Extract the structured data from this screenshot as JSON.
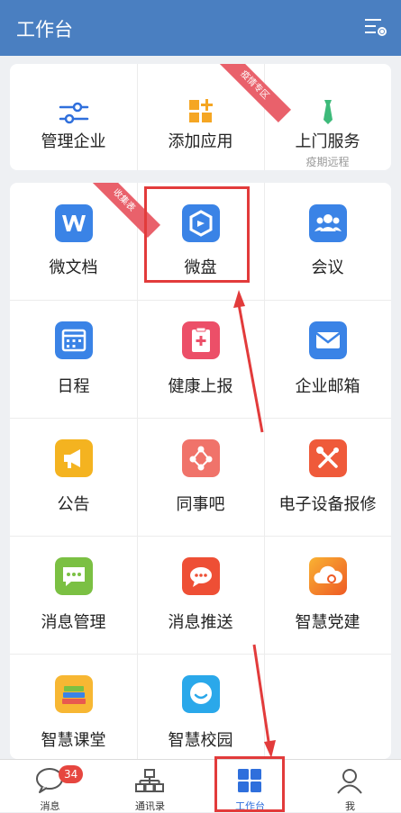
{
  "header": {
    "title": "工作台"
  },
  "top_apps": [
    {
      "label": "管理企业"
    },
    {
      "label": "添加应用",
      "ribbon": "疫情专区"
    },
    {
      "label": "上门服务",
      "sub": "疫期远程"
    }
  ],
  "apps": [
    {
      "label": "微文档",
      "ribbon": "收集表"
    },
    {
      "label": "微盘"
    },
    {
      "label": "会议"
    },
    {
      "label": "日程"
    },
    {
      "label": "健康上报"
    },
    {
      "label": "企业邮箱"
    },
    {
      "label": "公告"
    },
    {
      "label": "同事吧"
    },
    {
      "label": "电子设备报修"
    },
    {
      "label": "消息管理"
    },
    {
      "label": "消息推送"
    },
    {
      "label": "智慧党建"
    },
    {
      "label": "智慧课堂"
    },
    {
      "label": "智慧校园"
    }
  ],
  "tabs": [
    {
      "label": "消息",
      "badge": "34"
    },
    {
      "label": "通讯录"
    },
    {
      "label": "工作台"
    },
    {
      "label": "我"
    }
  ],
  "colors": {
    "header": "#4a7fc1",
    "accent": "#2f6fdc",
    "annotation": "#e23b3b"
  }
}
